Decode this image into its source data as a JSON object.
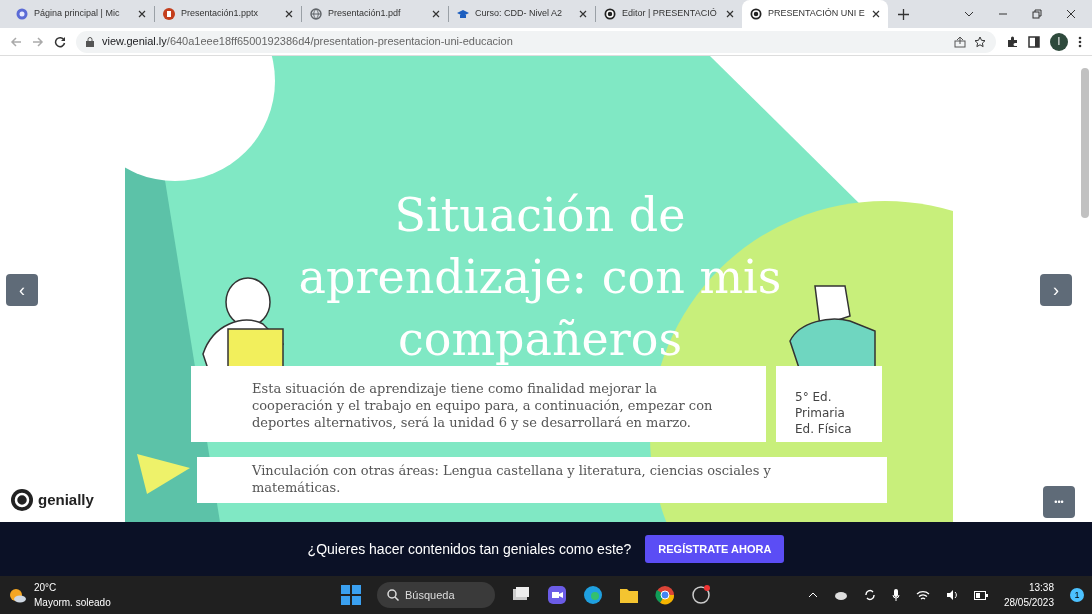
{
  "browser": {
    "tabs": [
      {
        "title": "Página principal | Mic",
        "kind": "app",
        "selected": false
      },
      {
        "title": "Presentación1.pptx",
        "kind": "document",
        "selected": false
      },
      {
        "title": "Presentación1.pdf",
        "kind": "web",
        "selected": false
      },
      {
        "title": "Curso: CDD- Nivel A2",
        "kind": "course",
        "selected": false
      },
      {
        "title": "Editor | PRESENTACIÓ",
        "kind": "site",
        "selected": false
      },
      {
        "title": "PRESENTACIÓN UNI E",
        "kind": "site",
        "selected": true
      }
    ],
    "url_host": "view.genial.ly",
    "url_path": "/640a1eee18ff6500192386d4/presentation-presentacion-uni-educacion",
    "profile": "I"
  },
  "slide": {
    "title": "Situación de aprendizaje: con mis compañeros",
    "description": "Esta situación de aprendizaje tiene como finalidad mejorar la cooperación y el trabajo en equipo para, a continuación, empezar con deportes alternativos, será la unidad 6 y se desarrollará en marzo.",
    "info_lines": [
      "5° Ed.",
      "Primaria",
      "Ed. Física"
    ],
    "links": "Vinculación con otras áreas: Lengua castellana y literatura, ciencias osciales y matemáticas."
  },
  "nav": {
    "prev": "‹",
    "next": "›",
    "more": "•••"
  },
  "logo": "genially",
  "banner": {
    "text": "¿Quieres hacer contenidos tan geniales como este?",
    "button": "REGÍSTRATE AHORA"
  },
  "taskbar": {
    "temperature": "20°C",
    "weather": "Mayorm. soleado",
    "search_placeholder": "Búsqueda",
    "time": "13:38",
    "date": "28/05/2023",
    "notifications": "1"
  }
}
